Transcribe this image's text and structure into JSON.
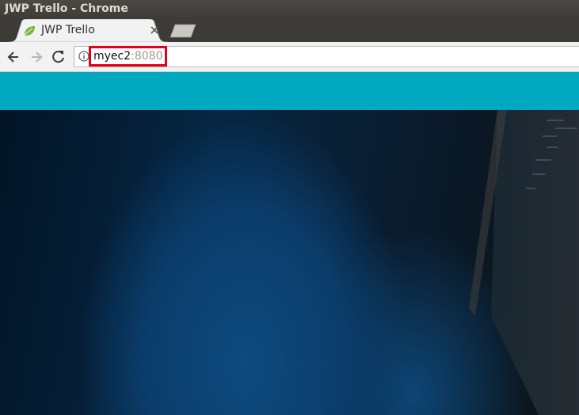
{
  "window": {
    "title": "JWP Trello - Chrome"
  },
  "tab": {
    "title": "JWP Trello",
    "favicon": "spring-leaf-icon",
    "favicon_color": "#7db343"
  },
  "address_bar": {
    "host": "myec2",
    "port": ":8080",
    "highlight_color": "#e2001a"
  },
  "page": {
    "navbar_color": "#00a8c0"
  }
}
